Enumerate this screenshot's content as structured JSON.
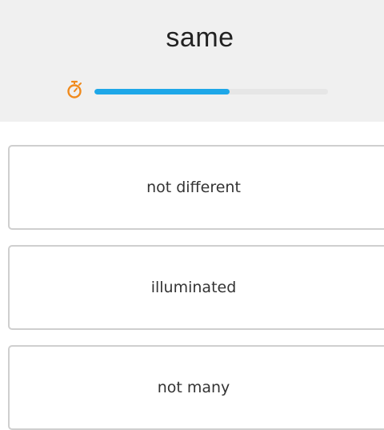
{
  "question": {
    "word": "same"
  },
  "timer": {
    "icon": "stopwatch-icon",
    "progress_percent": 58,
    "fill_color": "#1ea7e8",
    "icon_color": "#f08a1c"
  },
  "options": [
    {
      "label": "not different"
    },
    {
      "label": "illuminated"
    },
    {
      "label": "not many"
    }
  ]
}
